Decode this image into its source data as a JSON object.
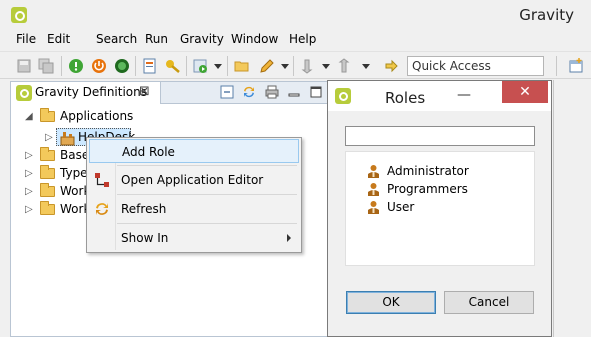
{
  "app": {
    "title": "Gravity"
  },
  "menubar": [
    "File",
    "Edit",
    "Search",
    "Run",
    "Gravity",
    "Window",
    "Help"
  ],
  "toolbar": {
    "quick_access_placeholder": "Quick Access",
    "icons": [
      "save-icon",
      "save-all-icon",
      "start-server-icon",
      "stop-server-icon",
      "run-green-icon",
      "new-file-icon",
      "key-icon",
      "run-icon",
      "open-folder-icon",
      "pencil-icon",
      "next-annotation-icon",
      "previous-annotation-icon",
      "back-icon",
      "pin-icon",
      "perspective-icon"
    ]
  },
  "view": {
    "tab_label": "Gravity Definitions",
    "close_glyph": "⊠",
    "tree": [
      {
        "label": "Applications",
        "expanded": true,
        "level": 0
      },
      {
        "label": "HelpDesk",
        "level": 1,
        "selected": true,
        "partially_hidden": true
      },
      {
        "label": "Base",
        "level": 0
      },
      {
        "label": "Type",
        "level": 0
      },
      {
        "label": "Work",
        "level": 0
      },
      {
        "label": "Work",
        "level": 0
      }
    ]
  },
  "context_menu": {
    "items": [
      {
        "label": "Add Role",
        "highlighted": true,
        "icon": ""
      },
      {
        "label": "Open Application Editor",
        "icon": "editor-icon"
      },
      {
        "label": "Refresh",
        "icon": "refresh-icon"
      },
      {
        "label": "Show In",
        "submenu": true,
        "icon": ""
      }
    ]
  },
  "dialog": {
    "title": "Roles",
    "minimize_glyph": "—",
    "close_glyph": "✕",
    "filter_value": "",
    "roles": [
      "Administrator",
      "Programmers",
      "User"
    ],
    "ok_label": "OK",
    "cancel_label": "Cancel"
  },
  "colors": {
    "selection": "#cde8ff",
    "dialog_close": "#c75050",
    "folder": "#f3c95b",
    "brand": "#b7cc3b"
  }
}
